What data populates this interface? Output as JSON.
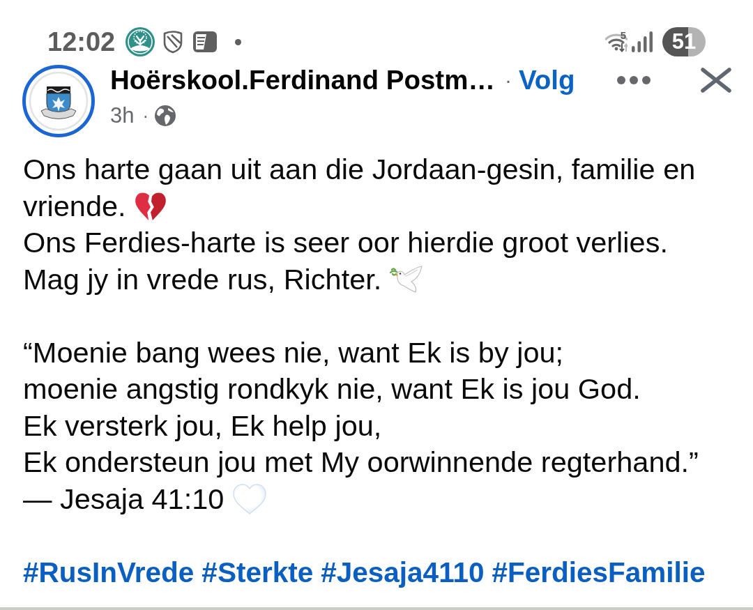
{
  "status_bar": {
    "time": "12:02",
    "wifi_label": "5",
    "battery": "51"
  },
  "post": {
    "author": "Hoërskool.Ferdinand Postm…",
    "follow_separator": "·",
    "follow": "Volg",
    "age": "3h",
    "age_separator": "·",
    "paragraphs": [
      {
        "lines": [
          {
            "text": "Ons harte gaan uit aan die Jordaan-gesin, familie en",
            "kind": "plain"
          },
          {
            "text": "vriende.",
            "kind": "broken_heart"
          },
          {
            "text": "Ons Ferdies-harte is seer oor hierdie groot verlies.",
            "kind": "plain"
          },
          {
            "text": "Mag jy in vrede rus, Richter.",
            "kind": "dove"
          }
        ]
      },
      {
        "lines": [
          {
            "text": "“Moenie bang wees nie, want Ek is by jou;",
            "kind": "plain"
          },
          {
            "text": "moenie angstig rondkyk nie, want Ek is jou God.",
            "kind": "plain"
          },
          {
            "text": "Ek versterk jou, Ek help jou,",
            "kind": "plain"
          },
          {
            "text": "Ek ondersteun jou met My oorwinnende regterhand.”",
            "kind": "plain"
          },
          {
            "text": "— Jesaja 41:10",
            "kind": "white_heart"
          }
        ]
      }
    ],
    "hashtags": [
      "#RusInVrede",
      "#Sterkte",
      "#Jesaja4110",
      "#FerdiesFamilie"
    ]
  }
}
